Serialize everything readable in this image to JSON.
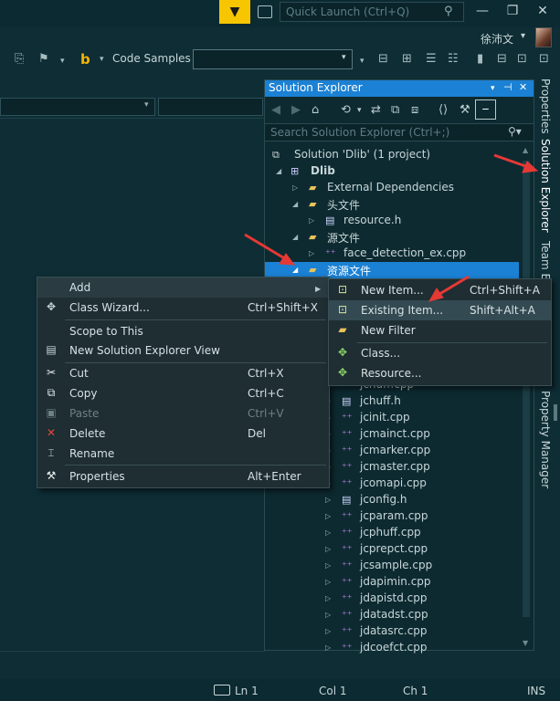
{
  "titlebar": {
    "quick_launch_placeholder": "Quick Launch (Ctrl+Q)",
    "filter_icon": "filter-icon",
    "window_buttons": [
      "—",
      "❐",
      "✕"
    ]
  },
  "user": {
    "name": "徐沛文",
    "caret": "▾"
  },
  "toolbar": {
    "code_samples_label": "Code Samples"
  },
  "solution_explorer": {
    "title": "Solution Explorer",
    "search_placeholder": "Search Solution Explorer (Ctrl+;)",
    "tree": [
      {
        "label": "Solution 'Dlib' (1 project)",
        "icon": "solution-icon"
      },
      {
        "label": "Dlib",
        "icon": "project-icon"
      },
      {
        "label": "External Dependencies",
        "icon": "folder-icon"
      },
      {
        "label": "头文件",
        "icon": "folder-icon"
      },
      {
        "label": "resource.h",
        "icon": "header-file-icon"
      },
      {
        "label": "源文件",
        "icon": "folder-icon"
      },
      {
        "label": "face_detection_ex.cpp",
        "icon": "cpp-file-icon"
      },
      {
        "label": "资源文件",
        "icon": "folder-icon"
      }
    ],
    "files": [
      {
        "label": "jchuff.cpp",
        "type": "cpp"
      },
      {
        "label": "jchuff.h",
        "type": "h"
      },
      {
        "label": "jcinit.cpp",
        "type": "cpp"
      },
      {
        "label": "jcmainct.cpp",
        "type": "cpp"
      },
      {
        "label": "jcmarker.cpp",
        "type": "cpp"
      },
      {
        "label": "jcmaster.cpp",
        "type": "cpp"
      },
      {
        "label": "jcomapi.cpp",
        "type": "cpp"
      },
      {
        "label": "jconfig.h",
        "type": "h"
      },
      {
        "label": "jcparam.cpp",
        "type": "cpp"
      },
      {
        "label": "jcphuff.cpp",
        "type": "cpp"
      },
      {
        "label": "jcprepct.cpp",
        "type": "cpp"
      },
      {
        "label": "jcsample.cpp",
        "type": "cpp"
      },
      {
        "label": "jdapimin.cpp",
        "type": "cpp"
      },
      {
        "label": "jdapistd.cpp",
        "type": "cpp"
      },
      {
        "label": "jdatadst.cpp",
        "type": "cpp"
      },
      {
        "label": "jdatasrc.cpp",
        "type": "cpp"
      },
      {
        "label": "jdcoefct.cpp",
        "type": "cpp"
      }
    ]
  },
  "side_tabs": {
    "properties": "Properties",
    "solution_explorer": "Solution Explorer",
    "team_explorer": "Team E",
    "property_manager": "Property Manager"
  },
  "context_menu": {
    "items": [
      {
        "label": "Add",
        "shortcut": "",
        "icon": ""
      },
      {
        "label": "Class Wizard...",
        "shortcut": "Ctrl+Shift+X",
        "icon": "class-wizard-icon"
      },
      {
        "label": "Scope to This",
        "shortcut": "",
        "icon": ""
      },
      {
        "label": "New Solution Explorer View",
        "shortcut": "",
        "icon": "new-view-icon"
      },
      {
        "label": "Cut",
        "shortcut": "Ctrl+X",
        "icon": "cut-icon"
      },
      {
        "label": "Copy",
        "shortcut": "Ctrl+C",
        "icon": "copy-icon"
      },
      {
        "label": "Paste",
        "shortcut": "Ctrl+V",
        "icon": "paste-icon"
      },
      {
        "label": "Delete",
        "shortcut": "Del",
        "icon": "delete-icon"
      },
      {
        "label": "Rename",
        "shortcut": "",
        "icon": "rename-icon"
      },
      {
        "label": "Properties",
        "shortcut": "Alt+Enter",
        "icon": "wrench-icon"
      }
    ]
  },
  "add_submenu": {
    "items": [
      {
        "label": "New Item...",
        "shortcut": "Ctrl+Shift+A",
        "icon": "new-item-icon"
      },
      {
        "label": "Existing Item...",
        "shortcut": "Shift+Alt+A",
        "icon": "existing-item-icon"
      },
      {
        "label": "New Filter",
        "shortcut": "",
        "icon": "new-filter-icon"
      },
      {
        "label": "Class...",
        "shortcut": "",
        "icon": "class-icon"
      },
      {
        "label": "Resource...",
        "shortcut": "",
        "icon": "resource-icon"
      }
    ]
  },
  "statusbar": {
    "ln": "Ln 1",
    "col": "Col 1",
    "ch": "Ch 1",
    "mode": "INS"
  },
  "colors": {
    "accent": "#1b81d4",
    "background": "#0e2d35",
    "filter_button": "#f7c600",
    "annotation_arrow": "#e53935"
  }
}
